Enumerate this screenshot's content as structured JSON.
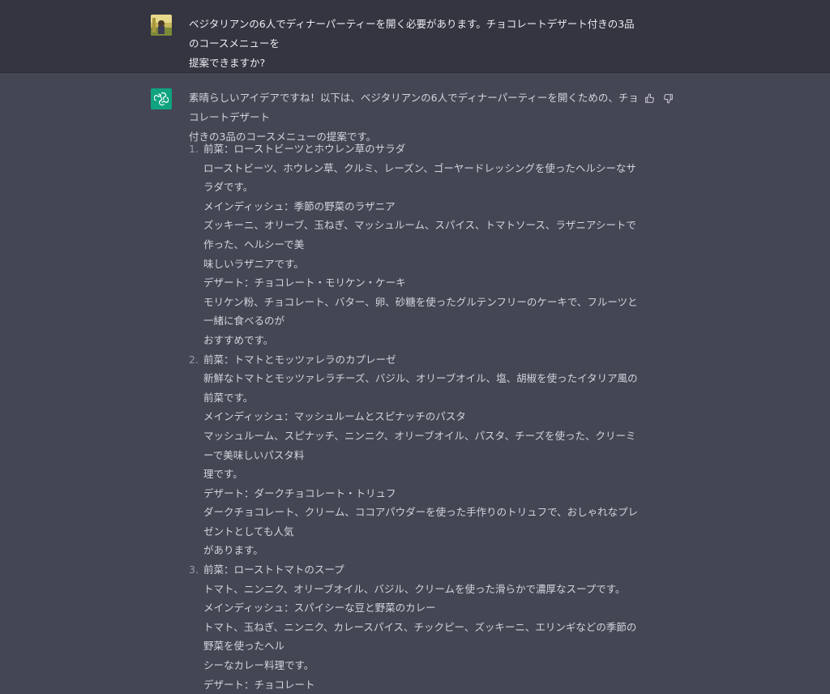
{
  "user": {
    "avatar_icon": "user-avatar-photo",
    "message_lines": [
      "ベジタリアンの6人でディナーパーティーを開く必要があります。チョコレートデザート付きの3品のコースメニューを",
      "提案できますか?"
    ]
  },
  "assistant": {
    "avatar_icon": "openai-logo-icon",
    "avatar_color": "#10a37f",
    "intro_lines": [
      "素晴らしいアイデアですね！以下は、ベジタリアンの6人でディナーパーティーを開くための、チョコレートデザート",
      "付きの3品のコースメニューの提案です。"
    ],
    "items": [
      {
        "number": "1.",
        "lines": [
          "前菜：ローストビーツとホウレン草のサラダ",
          "ローストビーツ、ホウレン草、クルミ、レーズン、ゴーヤードレッシングを使ったヘルシーなサラダです。",
          "メインディッシュ：季節の野菜のラザニア",
          "ズッキーニ、オリーブ、玉ねぎ、マッシュルーム、スパイス、トマトソース、ラザニアシートで作った、ヘルシーで美",
          "味しいラザニアです。",
          "デザート：チョコレート・モリケン・ケーキ",
          "モリケン粉、チョコレート、バター、卵、砂糖を使ったグルテンフリーのケーキで、フルーツと一緒に食べるのが",
          "おすすめです。"
        ]
      },
      {
        "number": "2.",
        "lines": [
          "前菜：トマトとモッツァレラのカプレーゼ",
          "新鮮なトマトとモッツァレラチーズ、バジル、オリーブオイル、塩、胡椒を使ったイタリア風の前菜です。",
          "メインディッシュ：マッシュルームとスピナッチのパスタ",
          "マッシュルーム、スピナッチ、ニンニク、オリーブオイル、パスタ、チーズを使った、クリーミーで美味しいパスタ料",
          "理です。",
          "デザート：ダークチョコレート・トリュフ",
          "ダークチョコレート、クリーム、ココアパウダーを使った手作りのトリュフで、おしゃれなプレゼントとしても人気",
          "があります。"
        ]
      },
      {
        "number": "3.",
        "lines": [
          "前菜：ローストトマトのスープ",
          "トマト、ニンニク、オリーブオイル、バジル、クリームを使った滑らかで濃厚なスープです。",
          "メインディッシュ：スパイシーな豆と野菜のカレー",
          "トマト、玉ねぎ、ニンニク、カレースパイス、チックピー、ズッキーニ、エリンギなどの季節の野菜を使ったヘル",
          "シーなカレー料理です。",
          "デザート：チョコレート"
        ]
      }
    ],
    "feedback": {
      "thumbs_up_icon": "thumbs-up-icon",
      "thumbs_down_icon": "thumbs-down-icon"
    }
  }
}
